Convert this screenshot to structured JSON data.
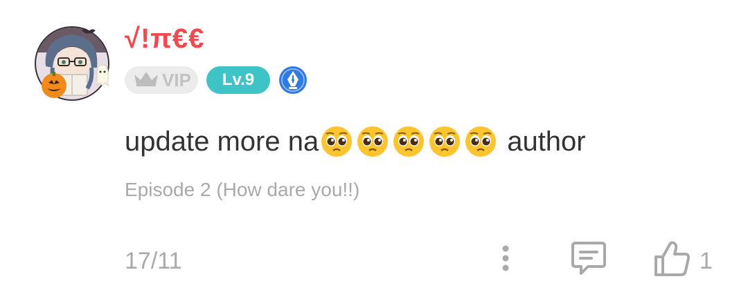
{
  "comment": {
    "username": "√!π€€",
    "avatar_icon": "user-avatar-halloween-anime",
    "badges": {
      "vip_label": "VIP",
      "vip_icon": "crown-icon",
      "level_label": "Lv.9",
      "author_icon": "pen-nib-icon"
    },
    "body": {
      "prefix": "update more na",
      "emoji": [
        "🥺",
        "🥺",
        "🥺",
        "🥺",
        "🥺"
      ],
      "suffix": "author"
    },
    "episode": "Episode 2 (How dare you!!)",
    "date": "17/11",
    "actions": {
      "more_icon": "more-vertical-icon",
      "reply_icon": "reply-comment-icon",
      "like_icon": "thumbs-up-icon",
      "like_count": "1"
    }
  },
  "colors": {
    "username": "#f0494e",
    "level_badge": "#3ec3c6",
    "vip_badge_bg": "#ececec",
    "author_badge": "#2f7be0",
    "muted_text": "#a9a9a9",
    "body_text": "#333333"
  }
}
